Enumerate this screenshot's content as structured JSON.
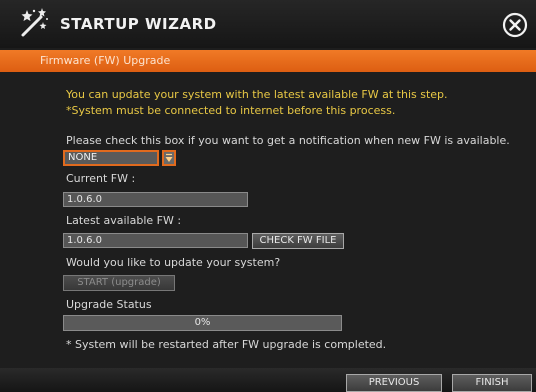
{
  "window": {
    "title": "STARTUP WIZARD",
    "close_icon": "close-circle-icon"
  },
  "section": {
    "title": "Firmware (FW) Upgrade"
  },
  "intro": {
    "line1": "You can update your system with the latest available FW at this step.",
    "line2": "*System must be connected to internet before this process."
  },
  "notify": {
    "label": "Please check this box if you want to get a notification when new FW is available.",
    "selected": "NONE"
  },
  "current_fw": {
    "label": "Current FW :",
    "value": "1.0.6.0"
  },
  "latest_fw": {
    "label": "Latest available FW :",
    "value": "1.0.6.0",
    "check_button": "CHECK FW FILE"
  },
  "update": {
    "question": "Would you like to update your system?",
    "start_button": "START (upgrade)"
  },
  "status": {
    "label": "Upgrade Status",
    "progress_label": "0%",
    "progress": 0
  },
  "footnote": "* System will be restarted after FW upgrade is completed.",
  "footer": {
    "previous": "PREVIOUS",
    "finish": "FINISH"
  },
  "colors": {
    "accent": "#e06a1e",
    "highlight_text": "#e8c845"
  }
}
